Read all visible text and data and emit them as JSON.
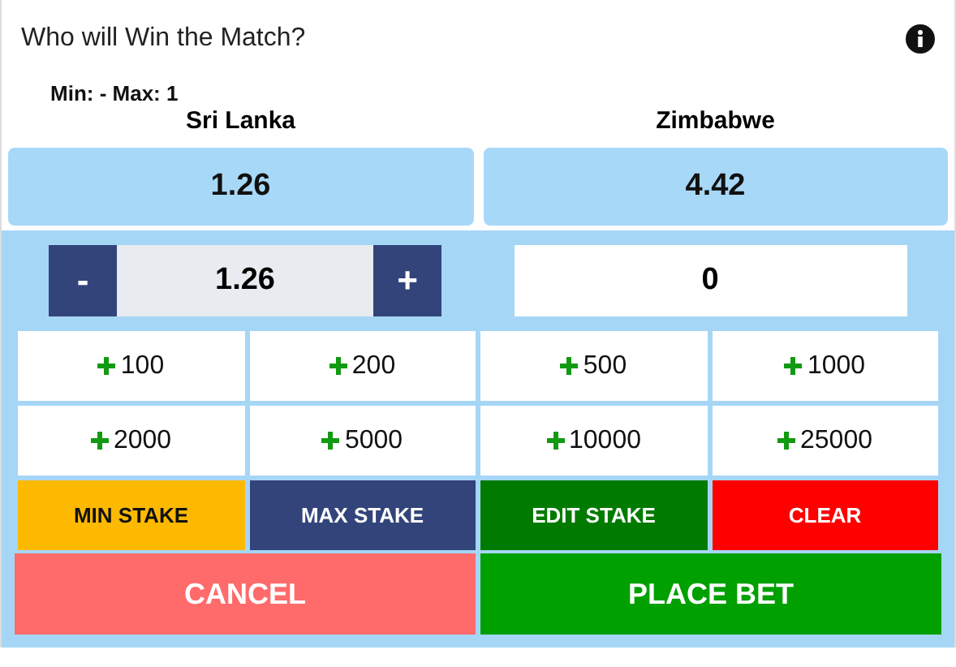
{
  "header": {
    "title": "Who will Win the Match?"
  },
  "limits": "Min: - Max: 1",
  "teams": [
    {
      "name": "Sri Lanka",
      "odds": "1.26"
    },
    {
      "name": "Zimbabwe",
      "odds": "4.42"
    }
  ],
  "stepper": {
    "decrement": "-",
    "value": "1.26",
    "increment": "+"
  },
  "stake": {
    "value": "0"
  },
  "quick_stakes": [
    "100",
    "200",
    "500",
    "1000",
    "2000",
    "5000",
    "10000",
    "25000"
  ],
  "stake_actions": [
    {
      "label": "MIN STAKE",
      "kind": "min"
    },
    {
      "label": "MAX STAKE",
      "kind": "max"
    },
    {
      "label": "EDIT STAKE",
      "kind": "edit"
    },
    {
      "label": "CLEAR",
      "kind": "clear"
    }
  ],
  "buttons": [
    {
      "label": "CANCEL",
      "kind": "cancel"
    },
    {
      "label": "PLACE BET",
      "kind": "place"
    }
  ]
}
